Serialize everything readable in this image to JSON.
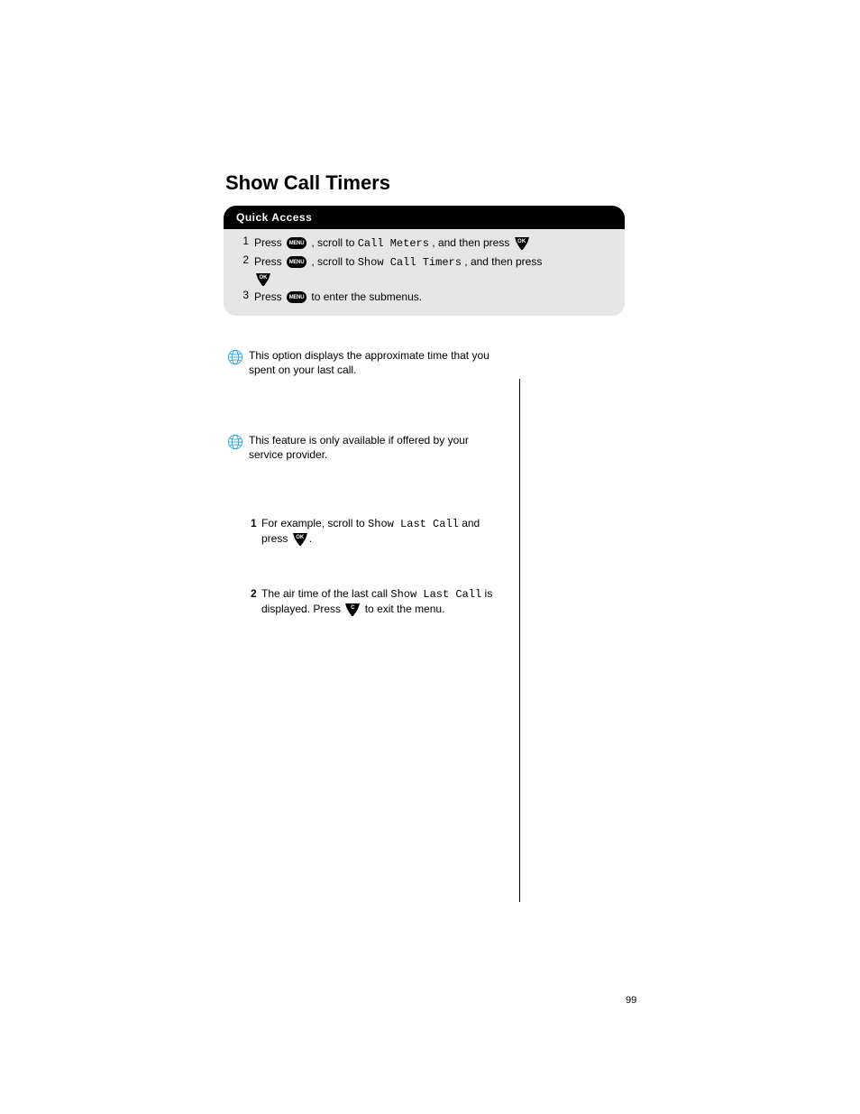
{
  "section_title": "Show Call Timers",
  "quick_access": {
    "header": "Quick Access",
    "steps": [
      {
        "num": "1",
        "before": "Press ",
        "icon": "menu",
        "after_1": ", scroll to ",
        "mono": "Call Meters",
        "after_2": ", and then press ",
        "trailing_icon": "ok"
      },
      {
        "num": "2",
        "before": "Press ",
        "icon": "menu",
        "after_1": ", scroll to ",
        "mono": "Show Call Timers",
        "after_2": ", and then press",
        "second_line_icon": "ok"
      },
      {
        "num": "3",
        "before": "Press ",
        "icon": "menu",
        "after_1": " to enter the submenus."
      }
    ]
  },
  "globe1": "This option displays the approximate time that you spent on your last call.",
  "globe2": "This feature is only available if offered by your service provider.",
  "step1": {
    "num": "1",
    "before": "For example, scroll to ",
    "mono": "Show Last Call",
    "after": " and press ",
    "icon": "ok",
    "period": "."
  },
  "step2": {
    "num": "2",
    "before": "The air time of the last call ",
    "mono": "Show Last Call",
    "after": " is displayed. Press ",
    "icon": "c",
    "after2": " to exit the menu."
  },
  "page_number": "99"
}
